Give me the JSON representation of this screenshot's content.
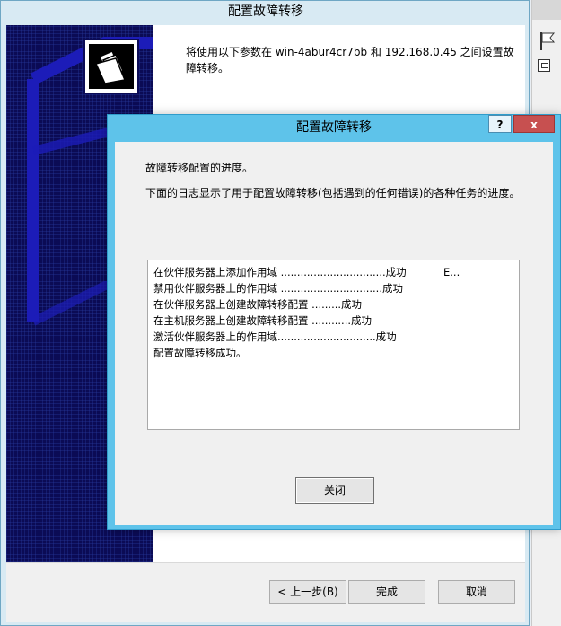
{
  "wizard": {
    "title": "配置故障转移",
    "description": "将使用以下参数在 win-4abur4cr7bb 和 192.168.0.45 之间设置故障转移。",
    "buttons": {
      "back": "< 上一步(B)",
      "finish": "完成",
      "cancel": "取消"
    }
  },
  "dialog": {
    "title": "配置故障转移",
    "help_label": "?",
    "close_label": "x",
    "progress_label": "故障转移配置的进度。",
    "log_description": "下面的日志显示了用于配置故障转移(包括遇到的任何错误)的各种任务的进度。",
    "log": [
      "在伙伴服务器上添加作用域 ................................成功",
      "禁用伙伴服务器上的作用域 ...............................成功",
      "在伙伴服务器上创建故障转移配置 .........成功",
      "在主机服务器上创建故障转移配置 ............成功",
      "激活伙伴服务器上的作用域..............................成功",
      "配置故障转移成功。"
    ],
    "log_extra": "E...",
    "close_button": "关闭"
  },
  "colors": {
    "dialog_frame": "#5ec3ea",
    "close_red": "#c75050",
    "wizard_banner": "#0b0b55"
  }
}
